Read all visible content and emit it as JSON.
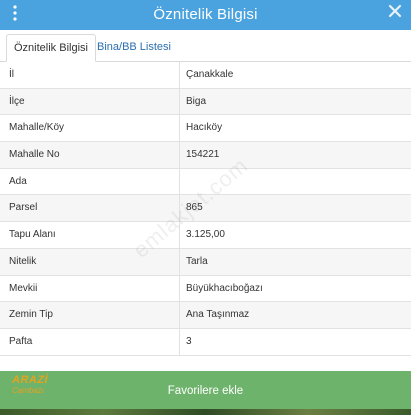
{
  "header": {
    "title": "Öznitelik Bilgisi"
  },
  "tabs": [
    {
      "label": "Öznitelik Bilgisi",
      "active": true
    },
    {
      "label": "Bina/BB Listesi",
      "active": false
    }
  ],
  "attributes": [
    {
      "key": "İl",
      "value": "Çanakkale"
    },
    {
      "key": "İlçe",
      "value": "Biga"
    },
    {
      "key": "Mahalle/Köy",
      "value": "Hacıköy"
    },
    {
      "key": "Mahalle No",
      "value": "154221"
    },
    {
      "key": "Ada",
      "value": ""
    },
    {
      "key": "Parsel",
      "value": "865"
    },
    {
      "key": "Tapu Alanı",
      "value": "3.125,00"
    },
    {
      "key": "Nitelik",
      "value": "Tarla"
    },
    {
      "key": "Mevkii",
      "value": "Büyükhacıboğazı"
    },
    {
      "key": "Zemin Tip",
      "value": "Ana Taşınmaz"
    },
    {
      "key": "Pafta",
      "value": "3"
    }
  ],
  "watermark": "emlakjet.com",
  "footer": {
    "favorite_button": "Favorilere ekle"
  },
  "logo": {
    "top": "ARAZİ",
    "bottom": "Cambazı"
  },
  "colors": {
    "header_bg": "#4aa3df",
    "footer_bg": "#6eb36c",
    "tab_active_text": "#333333",
    "tab_link_text": "#2a6fb0",
    "logo_color": "#e5a21d"
  }
}
